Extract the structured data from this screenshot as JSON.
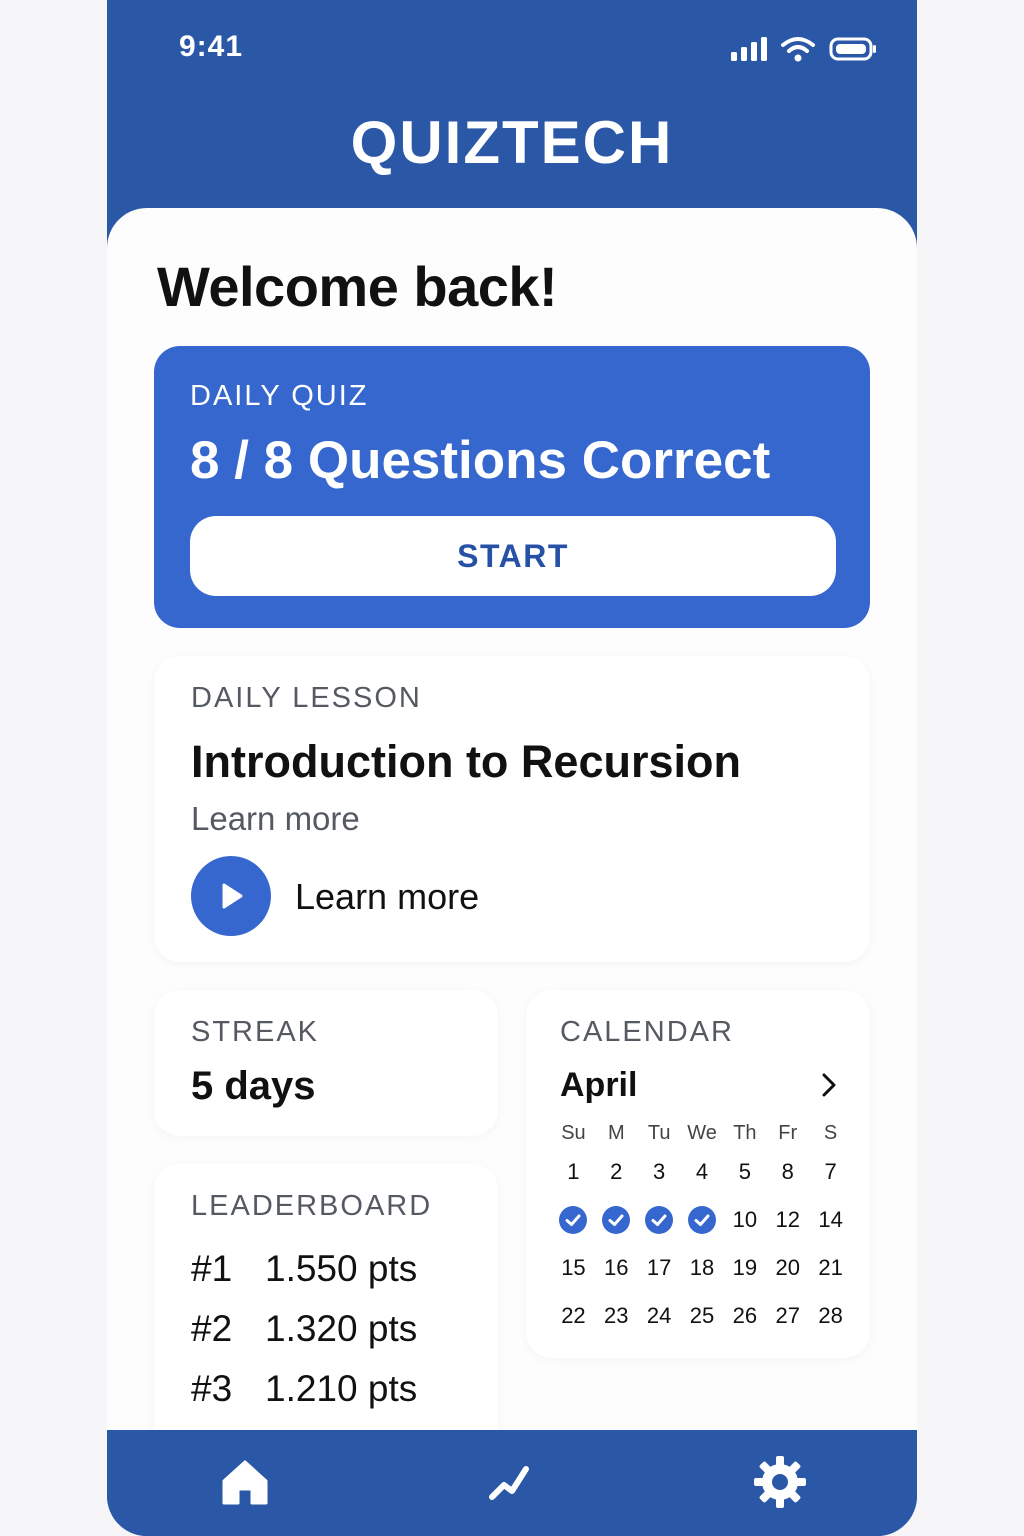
{
  "status_bar": {
    "time": "9:41"
  },
  "header": {
    "title": "QUIZTECH"
  },
  "welcome": "Welcome back!",
  "daily_quiz": {
    "label": "DAILY QUIZ",
    "score": "8 / 8 Questions Correct",
    "button": "START"
  },
  "daily_lesson": {
    "label": "DAILY LESSON",
    "title": "Introduction to Recursion",
    "subtitle": "Learn more",
    "play_label": "Learn more"
  },
  "streak": {
    "label": "STREAK",
    "value": "5 days"
  },
  "leaderboard": {
    "label": "LEADERBOARD",
    "rows": [
      {
        "rank": "#1",
        "points": "1.550 pts"
      },
      {
        "rank": "#2",
        "points": "1.320 pts"
      },
      {
        "rank": "#3",
        "points": "1.210 pts"
      }
    ]
  },
  "calendar": {
    "label": "CALENDAR",
    "month": "April",
    "weekdays": [
      "Su",
      "M",
      "Tu",
      "We",
      "Th",
      "Fr",
      "S"
    ],
    "weeks": [
      [
        "1",
        "2",
        "3",
        "4",
        "5",
        "8",
        "7"
      ],
      [
        "check",
        "check",
        "check",
        "check",
        "10",
        "12",
        "14"
      ],
      [
        "15",
        "16",
        "17",
        "18",
        "19",
        "20",
        "21"
      ],
      [
        "22",
        "23",
        "24",
        "25",
        "26",
        "27",
        "28"
      ]
    ]
  },
  "tab_bar": {
    "items": [
      {
        "icon": "home-icon"
      },
      {
        "icon": "trend-icon"
      },
      {
        "icon": "gear-icon"
      }
    ]
  },
  "colors": {
    "primary": "#2b57a7",
    "accent": "#3567cf",
    "background": "#fdfdfe"
  }
}
